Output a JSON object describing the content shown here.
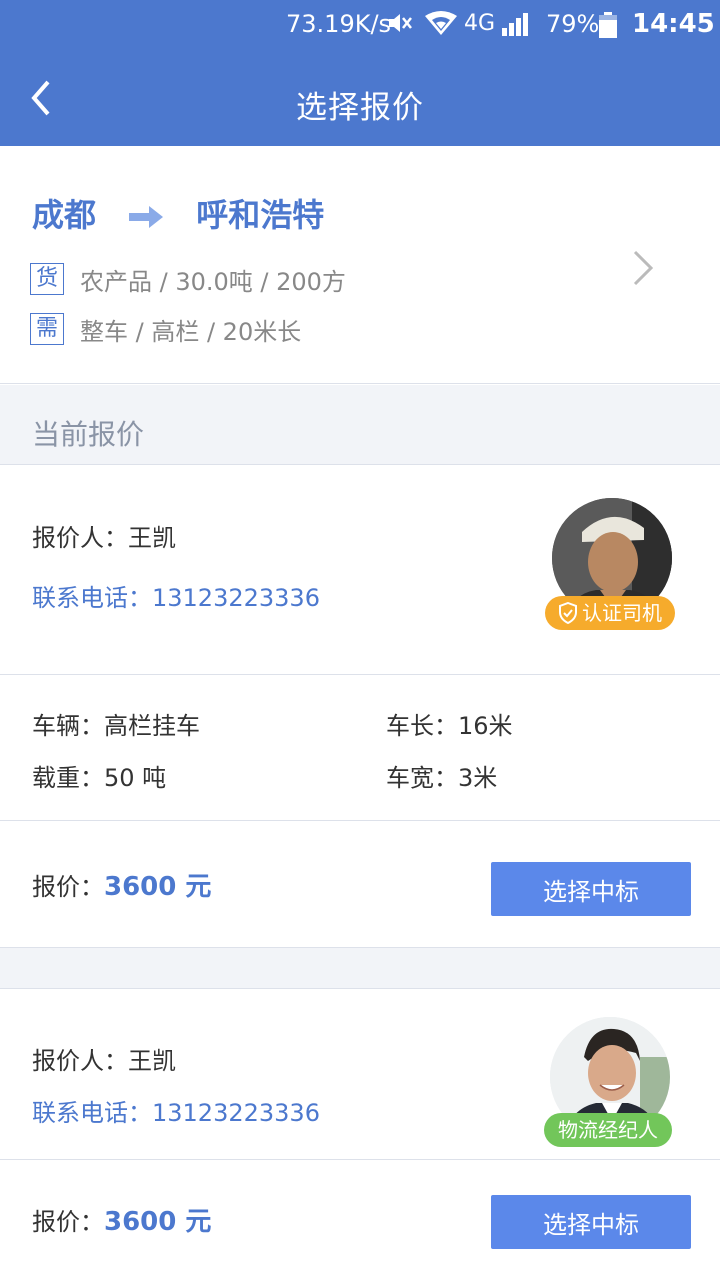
{
  "status_bar": {
    "net_speed": "73.19K/s",
    "network": "4G",
    "battery_percent": "79%",
    "time": "14:45",
    "icons": [
      "mute-icon",
      "wifi-icon",
      "signal-icon",
      "battery-icon"
    ]
  },
  "header": {
    "title": "选择报价",
    "back_icon": "chevron-left-icon"
  },
  "route": {
    "from": "成都",
    "to": "呼和浩特",
    "cargo_tag": "货",
    "cargo_info": "农产品 / 30.0吨 / 200方",
    "need_tag": "需",
    "need_info": "整车 / 高栏 / 20米长"
  },
  "section": {
    "title": "当前报价"
  },
  "quotes": [
    {
      "quoter_label": "报价人：",
      "quoter_name": "王凯",
      "phone_label": "联系电话：",
      "phone": "13123223336",
      "badge": "认证司机",
      "vehicle_label": "车辆：",
      "vehicle": "高栏挂车",
      "length_label": "车长：",
      "length": "16米",
      "load_label": "载重：",
      "load": "50 吨",
      "width_label": "车宽：",
      "width": "3米",
      "price_label": "报价：",
      "price": "3600 元",
      "button": "选择中标"
    },
    {
      "quoter_label": "报价人：",
      "quoter_name": "王凯",
      "phone_label": "联系电话：",
      "phone": "13123223336",
      "badge": "物流经纪人",
      "price_label": "报价：",
      "price": "3600 元",
      "button": "选择中标"
    }
  ],
  "colors": {
    "primary": "#4c78ce",
    "button": "#5b88ea",
    "badge_driver": "#f6ab2c",
    "badge_broker": "#72c65a",
    "background_gray": "#f2f4f8"
  }
}
